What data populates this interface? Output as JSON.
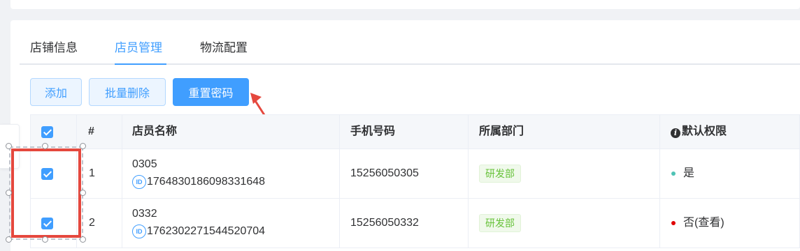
{
  "tabs": [
    "店铺信息",
    "店员管理",
    "物流配置"
  ],
  "active_tab": "店员管理",
  "actions": {
    "add": "添加",
    "batch_delete": "批量删除",
    "reset_password": "重置密码"
  },
  "table": {
    "headers": {
      "index": "#",
      "name": "店员名称",
      "phone": "手机号码",
      "department": "所属部门",
      "permission": "默认权限"
    },
    "rows": [
      {
        "index": "1",
        "name": "0305",
        "id_badge": "ID",
        "id": "1764830186098331648",
        "phone": "15256050305",
        "department": "研发部",
        "permission": "是",
        "permission_dot_color": "#4fc3b5",
        "checked": true
      },
      {
        "index": "2",
        "name": "0332",
        "id_badge": "ID",
        "id": "1762302271544520704",
        "phone": "15256050332",
        "department": "研发部",
        "permission": "否(查看)",
        "permission_dot_color": "#e00000",
        "checked": true
      }
    ]
  },
  "colors": {
    "primary": "#409eff",
    "annotation_red": "#e5483e",
    "tag_green": "#67c23a"
  },
  "icons": {
    "info": "info-circle-icon",
    "id": "id-badge-icon",
    "arrow": "annotation-arrow-icon"
  }
}
